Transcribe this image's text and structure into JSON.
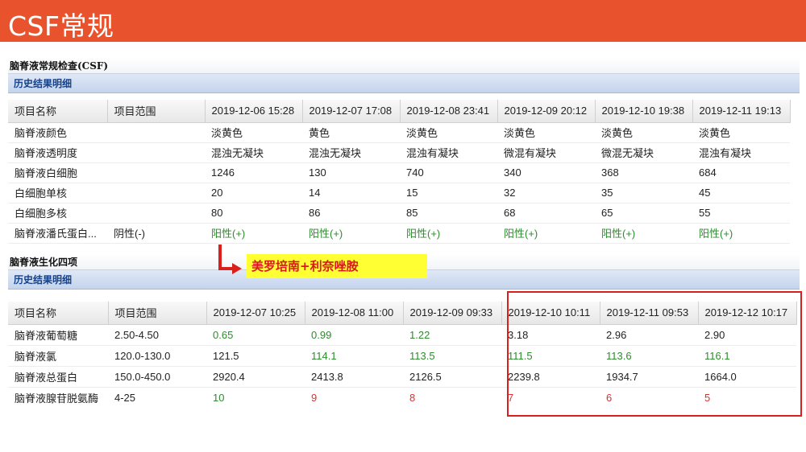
{
  "slide": {
    "title": "CSF常规"
  },
  "csf_routine": {
    "panel_title": "脑脊液常规检查(CSF)",
    "section_label": "历史结果明细",
    "columns": [
      "项目名称",
      "项目范围",
      "2019-12-06 15:28",
      "2019-12-07 17:08",
      "2019-12-08 23:41",
      "2019-12-09 20:12",
      "2019-12-10 19:38",
      "2019-12-11 19:13"
    ],
    "rows": [
      {
        "name": "脑脊液颜色",
        "range": "",
        "values": [
          "淡黄色",
          "黄色",
          "淡黄色",
          "淡黄色",
          "淡黄色",
          "淡黄色"
        ],
        "status": [
          "",
          "",
          "",
          "",
          "",
          ""
        ]
      },
      {
        "name": "脑脊液透明度",
        "range": "",
        "values": [
          "混浊无凝块",
          "混浊无凝块",
          "混浊有凝块",
          "微混有凝块",
          "微混无凝块",
          "混浊有凝块"
        ],
        "status": [
          "",
          "",
          "",
          "",
          "",
          ""
        ]
      },
      {
        "name": "脑脊液白细胞",
        "range": "",
        "values": [
          "1246",
          "130",
          "740",
          "340",
          "368",
          "684"
        ],
        "status": [
          "",
          "",
          "",
          "",
          "",
          ""
        ]
      },
      {
        "name": "白细胞单核",
        "range": "",
        "values": [
          "20",
          "14",
          "15",
          "32",
          "35",
          "45"
        ],
        "status": [
          "",
          "",
          "",
          "",
          "",
          ""
        ]
      },
      {
        "name": "白细胞多核",
        "range": "",
        "values": [
          "80",
          "86",
          "85",
          "68",
          "65",
          "55"
        ],
        "status": [
          "",
          "",
          "",
          "",
          "",
          ""
        ]
      },
      {
        "name": "脑脊液潘氏蛋白...",
        "range": "阴性(-)",
        "values": [
          "阳性(+)",
          "阳性(+)",
          "阳性(+)",
          "阳性(+)",
          "阳性(+)",
          "阳性(+)"
        ],
        "status": [
          "green",
          "green",
          "green",
          "green",
          "green",
          "green"
        ]
      }
    ]
  },
  "csf_biochem": {
    "panel_title": "脑脊液生化四项",
    "section_label": "历史结果明细",
    "columns": [
      "项目名称",
      "项目范围",
      "2019-12-07 10:25",
      "2019-12-08 11:00",
      "2019-12-09 09:33",
      "2019-12-10 10:11",
      "2019-12-11 09:53",
      "2019-12-12 10:17"
    ],
    "rows": [
      {
        "name": "脑脊液葡萄糖",
        "range": "2.50-4.50",
        "values": [
          "0.65",
          "0.99",
          "1.22",
          "3.18",
          "2.96",
          "2.90"
        ],
        "status": [
          "green",
          "green",
          "green",
          "",
          "",
          ""
        ]
      },
      {
        "name": "脑脊液氯",
        "range": "120.0-130.0",
        "values": [
          "121.5",
          "114.1",
          "113.5",
          "111.5",
          "113.6",
          "116.1"
        ],
        "status": [
          "",
          "green",
          "green",
          "green",
          "green",
          "green"
        ]
      },
      {
        "name": "脑脊液总蛋白",
        "range": "150.0-450.0",
        "values": [
          "2920.4",
          "2413.8",
          "2126.5",
          "2239.8",
          "1934.7",
          "1664.0"
        ],
        "status": [
          "",
          "",
          "",
          "",
          "",
          ""
        ]
      },
      {
        "name": "脑脊液腺苷脱氨酶",
        "range": "4-25",
        "values": [
          "10",
          "9",
          "8",
          "7",
          "6",
          "5"
        ],
        "status": [
          "green",
          "red",
          "red",
          "red",
          "red",
          "red"
        ]
      }
    ]
  },
  "annotation": {
    "callout_text": "美罗培南+利奈唑胺"
  }
}
